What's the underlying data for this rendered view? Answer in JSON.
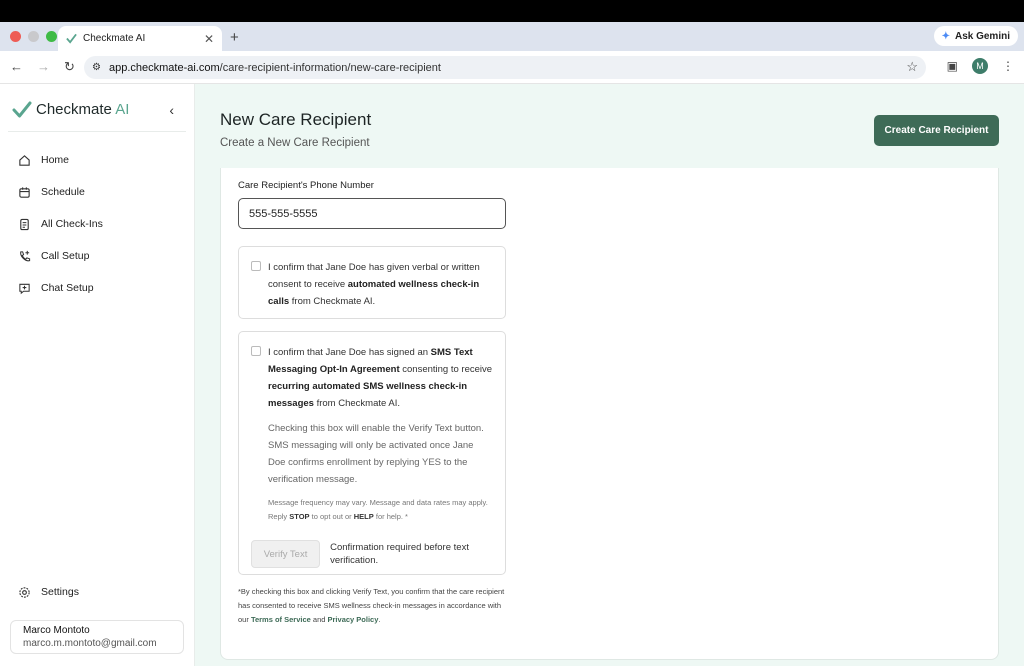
{
  "browser": {
    "tab_title": "Checkmate AI",
    "new_tab": "+",
    "close": "✕",
    "gemini": "Ask Gemini",
    "url_host": "app.checkmate-ai.com",
    "url_path": "/care-recipient-information/new-care-recipient",
    "profile_initial": "M"
  },
  "sidebar": {
    "brand": "Checkmate",
    "brand_ai": "AI",
    "items": [
      {
        "label": "Home"
      },
      {
        "label": "Schedule"
      },
      {
        "label": "All Check-Ins"
      },
      {
        "label": "Call Setup"
      },
      {
        "label": "Chat Setup"
      }
    ],
    "settings": "Settings",
    "user": {
      "name": "Marco Montoto",
      "email": "marco.m.montoto@gmail.com"
    }
  },
  "header": {
    "title": "New Care Recipient",
    "subtitle": "Create a New Care Recipient",
    "create_button": "Create Care Recipient"
  },
  "form": {
    "phone_label": "Care Recipient's Phone Number",
    "phone_value": "555-555-5555",
    "consent1": {
      "pre": "I confirm that Jane Doe has given verbal or written consent to receive ",
      "bold": "automated wellness check-in calls",
      "post": " from Checkmate AI."
    },
    "consent2": {
      "pre": "I confirm that Jane Doe has signed an ",
      "bold1": "SMS Text Messaging Opt-In Agreement",
      "mid": " consenting to receive ",
      "bold2": "recurring automated SMS wellness check-in messages",
      "post": " from Checkmate AI."
    },
    "note": "Checking this box will enable the Verify Text button. SMS messaging will only be activated once Jane Doe confirms enrollment by replying YES to the verification message.",
    "fine": {
      "pre": "Message frequency may vary. Message and data rates may apply. Reply ",
      "stop": "STOP",
      "mid": " to opt out or ",
      "help": "HELP",
      "post": " for help. *"
    },
    "verify_button": "Verify Text",
    "verify_note": "Confirmation required before text verification.",
    "disclaimer": {
      "pre": "*By checking this box and clicking Verify Text, you confirm that the care recipient has consented to receive SMS wellness check-in messages in accordance with our ",
      "tos": "Terms of Service",
      "and": " and ",
      "privacy": "Privacy Policy",
      "post": "."
    }
  }
}
